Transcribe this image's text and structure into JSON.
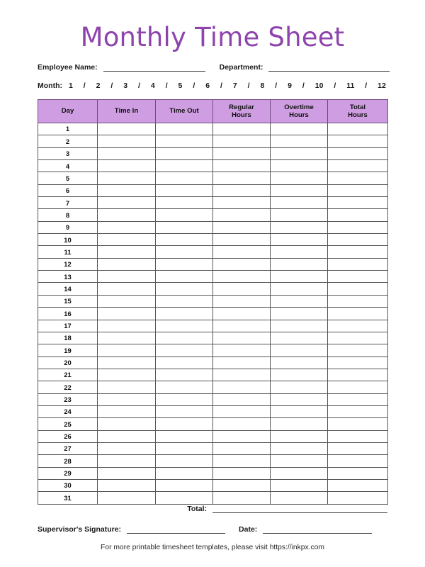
{
  "document": {
    "title": "Monthly Time Sheet",
    "title_color": "#8e44ad",
    "header_fill": "#cf9ee2",
    "header_border": "#6f4a80",
    "grid_border": "#555555"
  },
  "fields": {
    "employee_name_label": "Employee Name:",
    "employee_name_value": "",
    "department_label": "Department:",
    "department_value": "",
    "month_label": "Month:",
    "month_options": [
      "1",
      "2",
      "3",
      "4",
      "5",
      "6",
      "7",
      "8",
      "9",
      "10",
      "11",
      "12"
    ],
    "month_separator": "/",
    "month_selected": ""
  },
  "table": {
    "columns": [
      {
        "label": "Day"
      },
      {
        "label": "Time In"
      },
      {
        "label": "Time Out"
      },
      {
        "label": "Regular\nHours",
        "line1": "Regular",
        "line2": "Hours"
      },
      {
        "label": "Overtime\nHours",
        "line1": "Overtime",
        "line2": "Hours"
      },
      {
        "label": "Total\nHours",
        "line1": "Total",
        "line2": "Hours"
      }
    ],
    "rows": [
      {
        "day": "1",
        "time_in": "",
        "time_out": "",
        "regular_hours": "",
        "overtime_hours": "",
        "total_hours": ""
      },
      {
        "day": "2",
        "time_in": "",
        "time_out": "",
        "regular_hours": "",
        "overtime_hours": "",
        "total_hours": ""
      },
      {
        "day": "3",
        "time_in": "",
        "time_out": "",
        "regular_hours": "",
        "overtime_hours": "",
        "total_hours": ""
      },
      {
        "day": "4",
        "time_in": "",
        "time_out": "",
        "regular_hours": "",
        "overtime_hours": "",
        "total_hours": ""
      },
      {
        "day": "5",
        "time_in": "",
        "time_out": "",
        "regular_hours": "",
        "overtime_hours": "",
        "total_hours": ""
      },
      {
        "day": "6",
        "time_in": "",
        "time_out": "",
        "regular_hours": "",
        "overtime_hours": "",
        "total_hours": ""
      },
      {
        "day": "7",
        "time_in": "",
        "time_out": "",
        "regular_hours": "",
        "overtime_hours": "",
        "total_hours": ""
      },
      {
        "day": "8",
        "time_in": "",
        "time_out": "",
        "regular_hours": "",
        "overtime_hours": "",
        "total_hours": ""
      },
      {
        "day": "9",
        "time_in": "",
        "time_out": "",
        "regular_hours": "",
        "overtime_hours": "",
        "total_hours": ""
      },
      {
        "day": "10",
        "time_in": "",
        "time_out": "",
        "regular_hours": "",
        "overtime_hours": "",
        "total_hours": ""
      },
      {
        "day": "11",
        "time_in": "",
        "time_out": "",
        "regular_hours": "",
        "overtime_hours": "",
        "total_hours": ""
      },
      {
        "day": "12",
        "time_in": "",
        "time_out": "",
        "regular_hours": "",
        "overtime_hours": "",
        "total_hours": ""
      },
      {
        "day": "13",
        "time_in": "",
        "time_out": "",
        "regular_hours": "",
        "overtime_hours": "",
        "total_hours": ""
      },
      {
        "day": "14",
        "time_in": "",
        "time_out": "",
        "regular_hours": "",
        "overtime_hours": "",
        "total_hours": ""
      },
      {
        "day": "15",
        "time_in": "",
        "time_out": "",
        "regular_hours": "",
        "overtime_hours": "",
        "total_hours": ""
      },
      {
        "day": "16",
        "time_in": "",
        "time_out": "",
        "regular_hours": "",
        "overtime_hours": "",
        "total_hours": ""
      },
      {
        "day": "17",
        "time_in": "",
        "time_out": "",
        "regular_hours": "",
        "overtime_hours": "",
        "total_hours": ""
      },
      {
        "day": "18",
        "time_in": "",
        "time_out": "",
        "regular_hours": "",
        "overtime_hours": "",
        "total_hours": ""
      },
      {
        "day": "19",
        "time_in": "",
        "time_out": "",
        "regular_hours": "",
        "overtime_hours": "",
        "total_hours": ""
      },
      {
        "day": "20",
        "time_in": "",
        "time_out": "",
        "regular_hours": "",
        "overtime_hours": "",
        "total_hours": ""
      },
      {
        "day": "21",
        "time_in": "",
        "time_out": "",
        "regular_hours": "",
        "overtime_hours": "",
        "total_hours": ""
      },
      {
        "day": "22",
        "time_in": "",
        "time_out": "",
        "regular_hours": "",
        "overtime_hours": "",
        "total_hours": ""
      },
      {
        "day": "23",
        "time_in": "",
        "time_out": "",
        "regular_hours": "",
        "overtime_hours": "",
        "total_hours": ""
      },
      {
        "day": "24",
        "time_in": "",
        "time_out": "",
        "regular_hours": "",
        "overtime_hours": "",
        "total_hours": ""
      },
      {
        "day": "25",
        "time_in": "",
        "time_out": "",
        "regular_hours": "",
        "overtime_hours": "",
        "total_hours": ""
      },
      {
        "day": "26",
        "time_in": "",
        "time_out": "",
        "regular_hours": "",
        "overtime_hours": "",
        "total_hours": ""
      },
      {
        "day": "27",
        "time_in": "",
        "time_out": "",
        "regular_hours": "",
        "overtime_hours": "",
        "total_hours": ""
      },
      {
        "day": "28",
        "time_in": "",
        "time_out": "",
        "regular_hours": "",
        "overtime_hours": "",
        "total_hours": ""
      },
      {
        "day": "29",
        "time_in": "",
        "time_out": "",
        "regular_hours": "",
        "overtime_hours": "",
        "total_hours": ""
      },
      {
        "day": "30",
        "time_in": "",
        "time_out": "",
        "regular_hours": "",
        "overtime_hours": "",
        "total_hours": ""
      },
      {
        "day": "31",
        "time_in": "",
        "time_out": "",
        "regular_hours": "",
        "overtime_hours": "",
        "total_hours": ""
      }
    ]
  },
  "footer": {
    "total_label": "Total:",
    "total_value": "",
    "supervisor_label": "Supervisor's Signature:",
    "supervisor_value": "",
    "date_label": "Date:",
    "date_value": "",
    "note": "For more printable timesheet templates, please visit https://inkpx.com"
  }
}
